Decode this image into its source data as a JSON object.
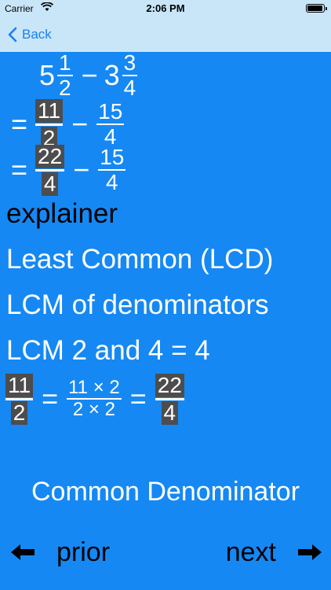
{
  "status": {
    "carrier": "Carrier",
    "time": "2:06 PM"
  },
  "nav": {
    "back_label": "Back"
  },
  "problem": {
    "whole1": "5",
    "n1": "1",
    "d1": "2",
    "op": "−",
    "whole2": "3",
    "n2": "3",
    "d2": "4"
  },
  "step1": {
    "eq": "=",
    "n1": "11",
    "d1": "2",
    "op": "−",
    "n2": "15",
    "d2": "4"
  },
  "step2": {
    "eq": "=",
    "n1": "22",
    "d1": "4",
    "op": "−",
    "n2": "15",
    "d2": "4"
  },
  "explainer": {
    "title": "explainer",
    "line1": "Least Common (LCD)",
    "line2": "LCM of denominators",
    "line3": "LCM 2 and 4 = 4",
    "calc": {
      "n1": "11",
      "d1": "2",
      "eq1": "=",
      "mn": "11 × 2",
      "md": "2 × 2",
      "eq2": "=",
      "n2": "22",
      "d2": "4"
    }
  },
  "footer": {
    "title": "Common Denominator",
    "prior_label": "prior",
    "next_label": "next"
  },
  "colors": {
    "background": "#1688f3",
    "nav": "#c9e6f8",
    "accent": "#1a7ff0",
    "box": "#4d4d4d"
  }
}
